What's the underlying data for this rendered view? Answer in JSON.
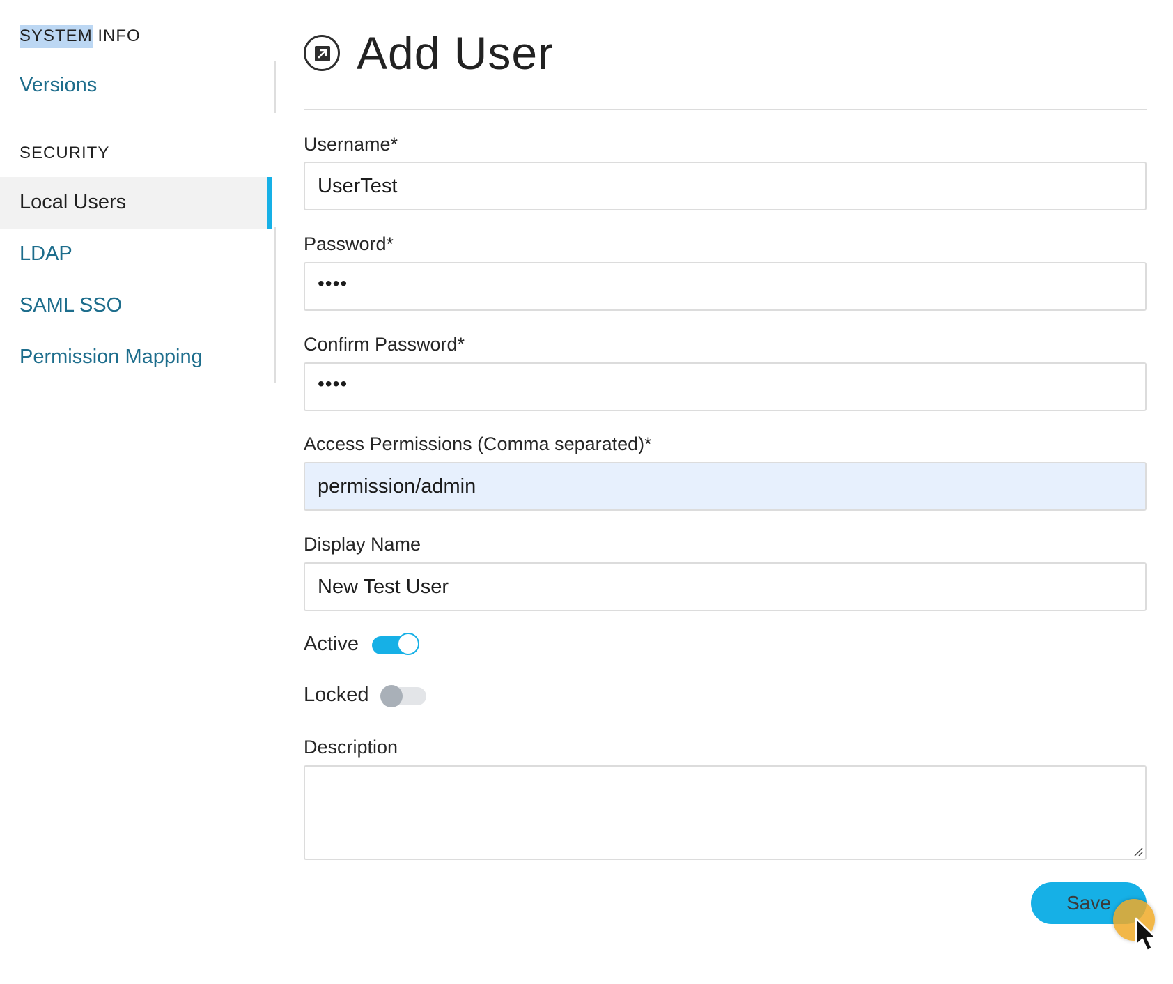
{
  "sidebar": {
    "system_info_highlight": "SYSTEM",
    "system_info_rest": " INFO",
    "versions": "Versions",
    "security": "SECURITY",
    "local_users": "Local Users",
    "ldap": "LDAP",
    "saml_sso": "SAML SSO",
    "permission_mapping": "Permission Mapping"
  },
  "main": {
    "title": "Add User",
    "title_icon": "external-link-icon",
    "username": {
      "label": "Username*",
      "value": "UserTest"
    },
    "password": {
      "label": "Password*",
      "value": "••••"
    },
    "confirm_password": {
      "label": "Confirm Password*",
      "value": "••••"
    },
    "access_permissions": {
      "label": "Access Permissions (Comma separated)*",
      "value": "permission/admin"
    },
    "display_name": {
      "label": "Display Name",
      "value": "New Test User"
    },
    "active": {
      "label": "Active",
      "on": true
    },
    "locked": {
      "label": "Locked",
      "on": false
    },
    "description": {
      "label": "Description",
      "value": ""
    },
    "save_label": "Save"
  },
  "colors": {
    "accent": "#16b0e6",
    "link": "#1d6d8c",
    "autofill_bg": "#e7f0fd"
  }
}
